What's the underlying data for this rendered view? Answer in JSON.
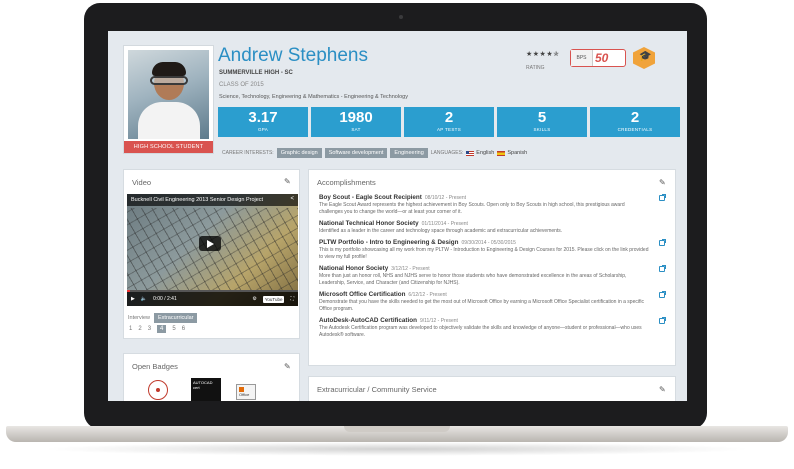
{
  "profile": {
    "name": "Andrew Stephens",
    "school": "SUMMERVILLE HIGH - SC",
    "class_of": "CLASS OF 2015",
    "pathway": "Science, Technology, Engineering & Mathematics - Engineering & Technology",
    "photo_label": "HIGH SCHOOL STUDENT"
  },
  "rating": {
    "stars": "★★★★✯",
    "label": "RATING",
    "badge_number": "50",
    "badge_prefix": "BPS"
  },
  "stats": [
    {
      "value": "3.17",
      "label": "GPA"
    },
    {
      "value": "1980",
      "label": "SAT"
    },
    {
      "value": "2",
      "label": "AP TESTS"
    },
    {
      "value": "5",
      "label": "SKILLS"
    },
    {
      "value": "2",
      "label": "CREDENTIALS"
    }
  ],
  "interests": {
    "label": "CAREER INTERESTS:",
    "items": [
      "Graphic design",
      "Software development",
      "Engineering"
    ],
    "languages_label": "LANGUAGES:",
    "languages": [
      "English",
      "Spanish"
    ]
  },
  "video": {
    "panel_title": "Video",
    "video_title": "Bucknell Civil Engineering 2013 Senior Design Project",
    "time": "0:00 / 2:41",
    "progress": 0.02,
    "yt_logo": "YouTube",
    "tabs": [
      "Interview",
      "Extracurricular"
    ],
    "active_tab": "Extracurricular",
    "pages": [
      "1",
      "2",
      "3",
      "4",
      "5",
      "6"
    ],
    "current_page": "4"
  },
  "open_badges": {
    "panel_title": "Open Badges",
    "badge_dark_text": "AUTOCAD cert",
    "badge_office_text": "Office"
  },
  "accomplishments": {
    "panel_title": "Accomplishments",
    "items": [
      {
        "title": "Boy Scout - Eagle Scout Recipient",
        "date": "08/10/12 - Present",
        "desc": "The Eagle Scout Award represents the highest achievement in Boy Scouts. Open only to Boy Scouts in high school, this prestigious award challenges you to change the world—or at least your corner of it."
      },
      {
        "title": "National Technical Honor Society",
        "date": "01/11/2014 - Present",
        "desc": "Identified as a leader in the career and technology space through academic and extracurricular achievements."
      },
      {
        "title": "PLTW Portfolio - Intro to Engineering & Design",
        "date": "09/30/2014 - 05/30/2015",
        "desc": "This is my portfolio showcasing all my work from my PLTW - Introduction to Engineering & Design Courses for 2015. Please click on the link provided to view my full profile!"
      },
      {
        "title": "National Honor Society",
        "date": "3/12/12 - Present",
        "desc": "More than just an honor roll, NHS and NJHS serve to honor those students who have demonstrated excellence in the areas of Scholarship, Leadership, Service, and Character (and Citizenship for NJHS)."
      },
      {
        "title": "Microsoft Office Certification",
        "date": "6/12/12 - Present",
        "desc": "Demonstrate that you have the skills needed to get the most out of Microsoft Office by earning a Microsoft Office Specialist certification in a specific Office program."
      },
      {
        "title": "AutoDesk-AutoCAD Certification",
        "date": "9/11/12 - Present",
        "desc": "The Autodesk Certification program was developed to objectively validate the skills and knowledge of anyone—student or professional—who uses Autodesk® software."
      }
    ]
  },
  "extracurricular": {
    "panel_title": "Extracurricular / Community Service"
  },
  "colors": {
    "accent_blue": "#2b9ecf",
    "name_blue": "#2b8fc4",
    "red": "#d9534f",
    "orange": "#f0a33a"
  }
}
